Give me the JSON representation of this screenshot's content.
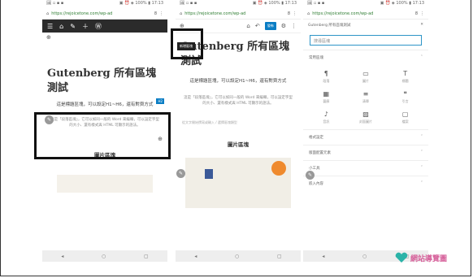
{
  "status_bar": {
    "left": "🖼 ▫ ▪ ▪",
    "right": "▣ ⏰ ◈ 100% ▮ 17:13"
  },
  "browser": {
    "url": "https://rejoicetone.com/wp-ad",
    "tab_count": "8"
  },
  "phone1": {
    "title": "Gutenberg 所有區塊測試",
    "highlighted_paragraph": "這是標題區塊，可以設定H1~H6，還有對齊方式",
    "badge": "H2",
    "small_paragraph": "這是「段落區塊」，它可以如同一般的 Word 來編輯，可以設定字型的大小、還有樣式與 HTML 可顯示的語法。",
    "heading": "圖片區塊"
  },
  "phone2": {
    "title": "Gutenberg 所有區塊測試",
    "paragraph": "這是標題區塊，可以設定H1~H6，還有對齊方式",
    "small_paragraph": "這是「段落區塊」，它可以如同一般的 Word 來編輯，可以設定字型的大小、還有樣式與 HTML 可顯示的語法。",
    "placeholder": "從文字開始撰寫或輸入 / 選擇區塊類型",
    "heading": "圖片區塊",
    "tooltip": "新增區塊",
    "publish": "發佈"
  },
  "phone3": {
    "header": "Gutenberg 所有區塊測試",
    "search_placeholder": "搜尋區塊",
    "section_common": "常用區塊",
    "blocks": [
      {
        "icon": "¶",
        "label": "段落"
      },
      {
        "icon": "▭",
        "label": "圖片"
      },
      {
        "icon": "T",
        "label": "標題"
      },
      {
        "icon": "▦",
        "label": "藝廊"
      },
      {
        "icon": "≡",
        "label": "清單"
      },
      {
        "icon": "❝",
        "label": "引言"
      },
      {
        "icon": "♪",
        "label": "音訊"
      },
      {
        "icon": "▨",
        "label": "封面圖片"
      },
      {
        "icon": "▢",
        "label": "檔案"
      }
    ],
    "categories": [
      "格式設定",
      "版面配置元素",
      "小工具",
      "嵌入內容"
    ]
  },
  "nav": {
    "back": "◂",
    "home": "○",
    "recent": "▢"
  },
  "watermark": {
    "text": "網站導覽圖"
  }
}
